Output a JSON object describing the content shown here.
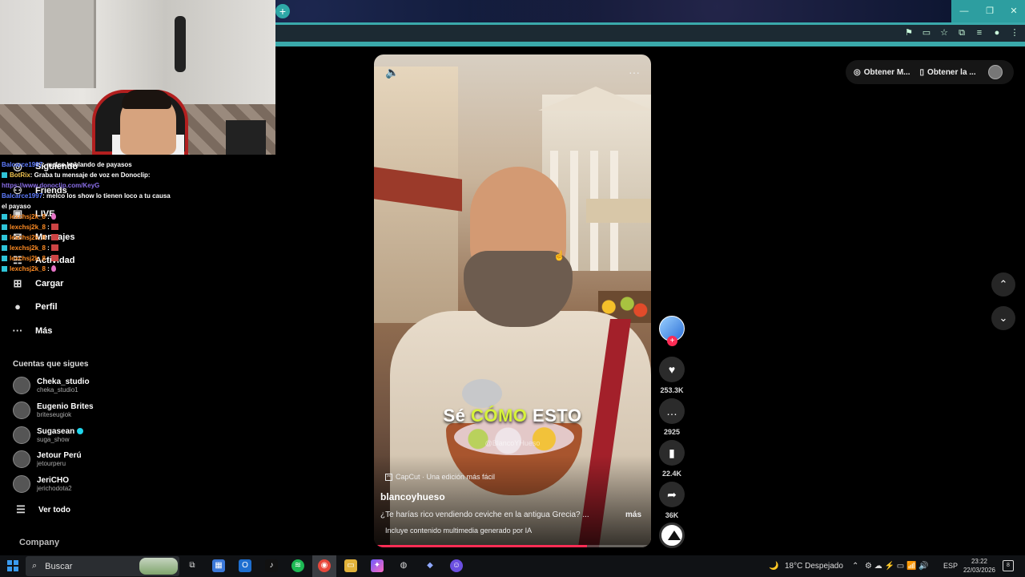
{
  "browser": {
    "new_tab_symbol": "+",
    "window_controls": {
      "minimize": "—",
      "maximize": "❐",
      "close": "✕"
    },
    "toolbar_icons": [
      "translate-icon",
      "cast-icon",
      "star-icon",
      "extensions-icon",
      "media-icon",
      "profile-icon",
      "menu-icon"
    ]
  },
  "sidebar": {
    "nav": [
      {
        "icon": "following-icon",
        "glyph": "◎",
        "label": "Siguiendo"
      },
      {
        "icon": "friends-icon",
        "glyph": "⚇",
        "label": "Friends"
      },
      {
        "icon": "live-icon",
        "glyph": "▣",
        "label": "LIVE"
      },
      {
        "icon": "messages-icon",
        "glyph": "✉",
        "label": "Mensajes"
      },
      {
        "icon": "activity-icon",
        "glyph": "☷",
        "label": "Actividad"
      },
      {
        "icon": "upload-icon",
        "glyph": "⊞",
        "label": "Cargar"
      },
      {
        "icon": "profile-icon",
        "glyph": "●",
        "label": "Perfil"
      },
      {
        "icon": "more-icon",
        "glyph": "···",
        "label": "Más"
      }
    ],
    "following_title": "Cuentas que sigues",
    "following": [
      {
        "name": "Cheka_studio",
        "handle": "cheka_studio1",
        "verified": false
      },
      {
        "name": "Eugenio Brites",
        "handle": "briteseugiok",
        "verified": false
      },
      {
        "name": "Sugasean",
        "handle": "suga_show",
        "verified": true
      },
      {
        "name": "Jetour Perú",
        "handle": "jetourperu",
        "verified": false
      },
      {
        "name": "JeriCHO",
        "handle": "jerichodota2",
        "verified": false
      }
    ],
    "see_all": "Ver todo",
    "company": "Company"
  },
  "chat": [
    {
      "user": "Balcarce1997",
      "text": ": melco hablando de payasos",
      "color": "u1"
    },
    {
      "user": "BotRix",
      "text": ": Graba tu mensaje de voz en Donoclip:",
      "color": "u2"
    },
    {
      "link": "https://www.donoclip.com/KeyG"
    },
    {
      "user": "Balcarce1997",
      "text": ": melco los show lo tienen loco a tu causa el payaso",
      "color": "u1"
    },
    {
      "user": "lexchsj2k_8",
      "text": " :",
      "color": "u3",
      "emote": "drop"
    },
    {
      "user": "lexchsj2k_8",
      "text": " :",
      "color": "u3",
      "emote": "block"
    },
    {
      "user": "lexchsj2k_8",
      "text": " :",
      "color": "u3",
      "emote": "block"
    },
    {
      "user": "lexchsj2k_8",
      "text": " :",
      "color": "u3",
      "emote": "block"
    },
    {
      "user": "lexchsj2k_8",
      "text": " :",
      "color": "u3",
      "emote": "block"
    },
    {
      "user": "lexchsj2k_8",
      "text": " :",
      "color": "u3",
      "emote": "drop"
    }
  ],
  "video": {
    "caption_a": "Sé ",
    "caption_highlight": "CÓMO",
    "caption_b": " ESTO",
    "watermark": "@BlancoYHueso",
    "capcut_label": "CapCut · Una edición más fácil",
    "author": "blancoyhueso",
    "description": "¿Te harías rico vendiendo ceviche en la antigua Grecia? ...",
    "more": "más",
    "ai_note": "Incluye contenido multimedia generado por IA",
    "progress": 0.77
  },
  "actions": {
    "likes": "253.3K",
    "comments": "2925",
    "saves": "22.4K",
    "shares": "36K"
  },
  "top_pills": {
    "get_coins": "Obtener M...",
    "get_app": "Obtener la ..."
  },
  "taskbar": {
    "search_placeholder": "Buscar",
    "weather": "18°C  Despejado",
    "lang": "ESP",
    "time": "23:22",
    "date": "22/03/2026",
    "notifications": "8"
  }
}
